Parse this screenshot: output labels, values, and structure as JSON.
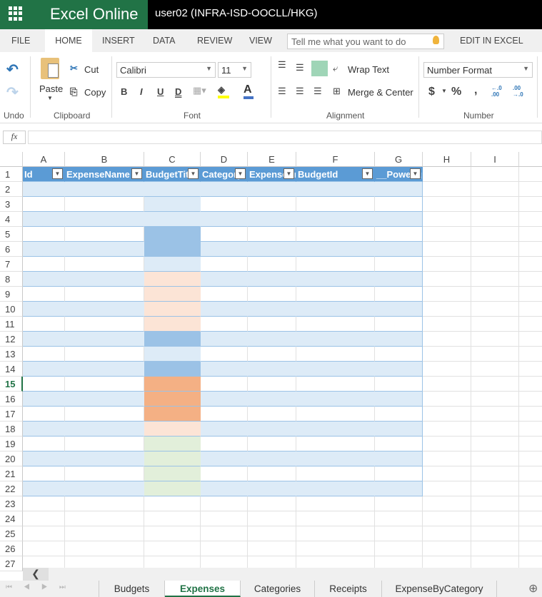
{
  "app": {
    "name": "Excel Online",
    "user": "user02 (INFRA-ISD-OOCLL/HKG)"
  },
  "ribbon_tabs": [
    "FILE",
    "HOME",
    "INSERT",
    "DATA",
    "REVIEW",
    "VIEW"
  ],
  "tell_me": {
    "placeholder": "Tell me what you want to do"
  },
  "edit_in_excel": "EDIT IN EXCEL",
  "groups": {
    "undo": {
      "label": "Undo"
    },
    "clipboard": {
      "label": "Clipboard",
      "paste": "Paste",
      "cut": "Cut",
      "copy": "Copy"
    },
    "font": {
      "label": "Font",
      "name": "Calibri",
      "size": "11",
      "bold": "B",
      "italic": "I",
      "underline": "U",
      "double_underline": "D",
      "font_color": "A"
    },
    "alignment": {
      "label": "Alignment",
      "wrap": "Wrap Text",
      "merge": "Merge & Center"
    },
    "number": {
      "label": "Number",
      "format": "Number Format",
      "currency": "$",
      "percent": "%",
      "comma": ",",
      "inc_decimal": "←.0 .00",
      "dec_decimal": ".00 →.0"
    }
  },
  "formula_bar": {
    "fx": "fx",
    "value": ""
  },
  "columns": [
    "A",
    "B",
    "C",
    "D",
    "E",
    "F",
    "G",
    "H",
    "I"
  ],
  "table_headers": [
    "Id",
    "ExpenseName",
    "BudgetTitle",
    "Category",
    "ExpenseAmount",
    "BudgetId",
    "__PowerAppsId__"
  ],
  "rows": [
    "1",
    "2",
    "3",
    "4",
    "5",
    "6",
    "7",
    "8",
    "9",
    "10",
    "11",
    "12",
    "13",
    "14",
    "15",
    "16",
    "17",
    "18",
    "19",
    "20",
    "21",
    "22",
    "23",
    "24",
    "25",
    "26",
    "27"
  ],
  "active_row": "15",
  "budget_title_fills": [
    "",
    "light-blue",
    "",
    "blue",
    "blue",
    "light-blue",
    "peach",
    "peach",
    "peach",
    "peach",
    "blue",
    "light-blue",
    "blue",
    "orange",
    "orange",
    "orange",
    "peach",
    "green",
    "green",
    "green",
    "green"
  ],
  "colors": {
    "brand": "#217346",
    "table_header": "#5b9bd5",
    "band": "#ddebf7",
    "light-blue": "#ddebf7",
    "blue": "#9bc2e6",
    "peach": "#fce4d6",
    "orange": "#f4b084",
    "green": "#e2efda"
  },
  "sheets": [
    "Budgets",
    "Expenses",
    "Categories",
    "Receipts",
    "ExpenseByCategory"
  ],
  "active_sheet": "Expenses"
}
